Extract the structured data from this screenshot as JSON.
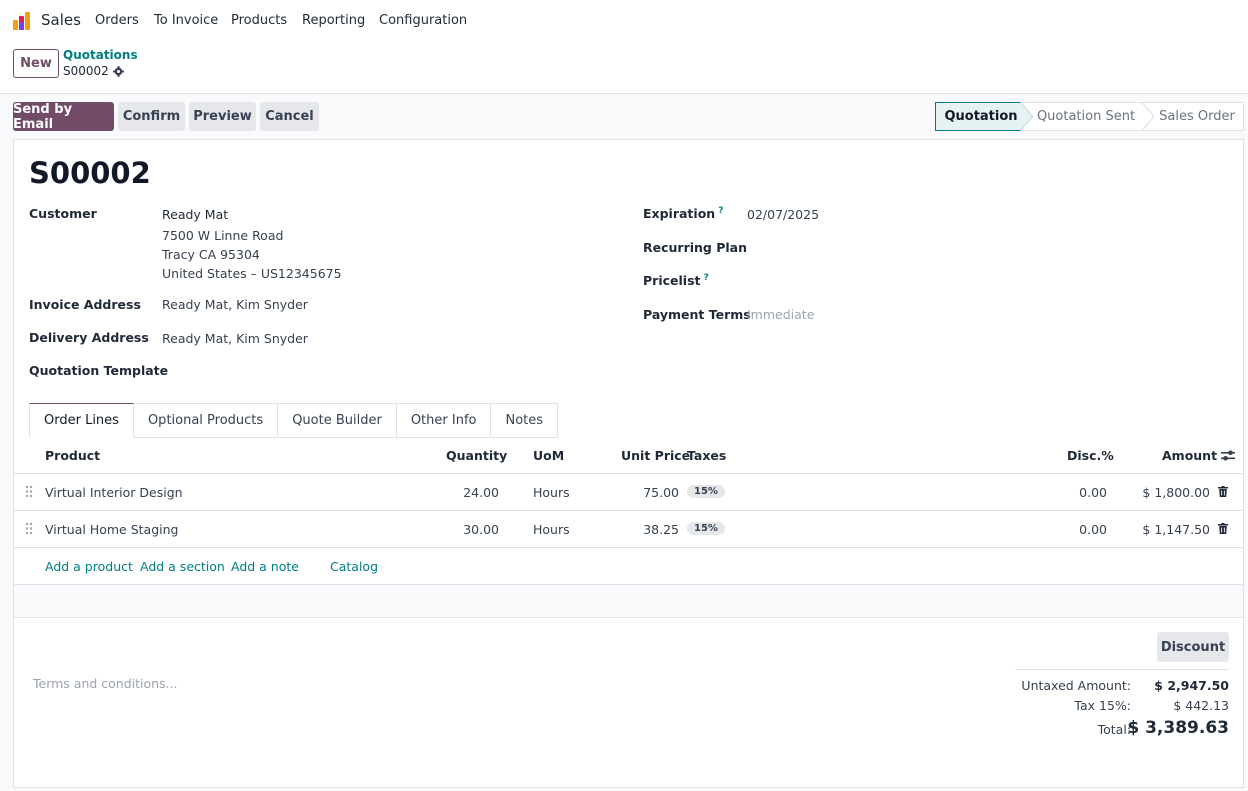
{
  "nav": {
    "app_name": "Sales",
    "menu": [
      "Orders",
      "To Invoice",
      "Products",
      "Reporting",
      "Configuration"
    ]
  },
  "control": {
    "new_label": "New",
    "breadcrumb_parent": "Quotations",
    "breadcrumb_current": "S00002"
  },
  "actions": {
    "send_email": "Send by Email",
    "confirm": "Confirm",
    "preview": "Preview",
    "cancel": "Cancel"
  },
  "statusbar": {
    "steps": [
      "Quotation",
      "Quotation Sent",
      "Sales Order"
    ],
    "active": "Quotation"
  },
  "form": {
    "title": "S00002",
    "customer_label": "Customer",
    "customer_lines": [
      "Ready Mat",
      "7500 W Linne Road",
      "Tracy CA 95304",
      "United States – US12345675"
    ],
    "invoice_address_label": "Invoice Address",
    "invoice_address": "Ready Mat, Kim Snyder",
    "delivery_address_label": "Delivery Address",
    "delivery_address": "Ready Mat, Kim Snyder",
    "quotation_template_label": "Quotation Template",
    "expiration_label": "Expiration",
    "expiration": "02/07/2025",
    "recurring_plan_label": "Recurring Plan",
    "pricelist_label": "Pricelist",
    "payment_terms_label": "Payment Terms",
    "payment_terms": "Immediate",
    "help_mark": "?"
  },
  "tabs": [
    "Order Lines",
    "Optional Products",
    "Quote Builder",
    "Other Info",
    "Notes"
  ],
  "table": {
    "headers": {
      "product": "Product",
      "quantity": "Quantity",
      "uom": "UoM",
      "unit_price": "Unit Price",
      "taxes": "Taxes",
      "disc": "Disc.%",
      "amount": "Amount"
    },
    "rows": [
      {
        "product": "Virtual Interior Design",
        "quantity": "24.00",
        "uom": "Hours",
        "unit_price": "75.00",
        "tax": "15%",
        "disc": "0.00",
        "amount": "$ 1,800.00"
      },
      {
        "product": "Virtual Home Staging",
        "quantity": "30.00",
        "uom": "Hours",
        "unit_price": "38.25",
        "tax": "15%",
        "disc": "0.00",
        "amount": "$ 1,147.50"
      }
    ],
    "add_product": "Add a product",
    "add_section": "Add a section",
    "add_note": "Add a note",
    "catalog": "Catalog"
  },
  "footer": {
    "discount_label": "Discount",
    "terms_placeholder": "Terms and conditions...",
    "untaxed_label": "Untaxed Amount:",
    "untaxed_value": "$ 2,947.50",
    "tax_label": "Tax 15%:",
    "tax_value": "$ 442.13",
    "total_label": "Total:",
    "total_value": "$ 3,389.63"
  },
  "colors": {
    "primary": "#714b67",
    "link": "#017e84",
    "status_active_bg": "#e6f2f3"
  }
}
